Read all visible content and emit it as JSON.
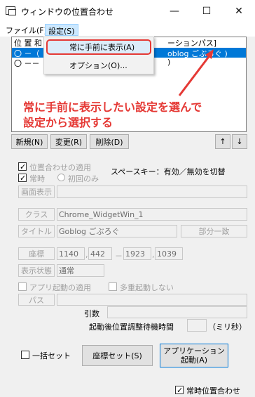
{
  "window": {
    "title": "ウィンドウの位置合わせ",
    "minimize": "—",
    "maximize": "☐",
    "close": "✕"
  },
  "menubar": {
    "file": "ファイル(F)",
    "settings": "設定(S)"
  },
  "dropdown": {
    "always_on_top": "常に手前に表示(A)",
    "options": "オプション(O)..."
  },
  "list": {
    "header_left": "位 置 和",
    "header_right": "ーションパス]",
    "row1_left": "〇 －（",
    "row1_right": "oblog ごぶろぐ )",
    "row2_left": "〇 －－",
    "row2_right": ")"
  },
  "annotation": {
    "line1": "常に手前に表示したい設定を選んで",
    "line2": "設定から選択する"
  },
  "buttons": {
    "new": "新規(N)",
    "edit": "変更(R)",
    "delete": "削除(D)",
    "up": "↑",
    "down": "↓"
  },
  "form": {
    "apply_position": "位置合わせの適用",
    "space_key_hint": "スペースキー：有効／無効を切替",
    "always": "常時",
    "first_only": "初回のみ",
    "screen_label": "画面表示",
    "class_label": "クラス",
    "class_value": "Chrome_WidgetWin_1",
    "title_label": "タイトル",
    "title_value": "Goblog ごぶろぐ",
    "partial_match": "部分一致",
    "coords_label": "座標",
    "x1": "1140",
    "y1": "442",
    "dash": "－",
    "x2": "1923",
    "y2": "1039",
    "display_state_label": "表示状態",
    "display_state_value": "通常",
    "apply_app_launch": "アプリ起動の適用",
    "no_multi_launch": "多重起動しない",
    "path_label": "パス",
    "args_label": "引数",
    "wait_label": "起動後位置調整待機時間",
    "wait_unit": "（ミリ秒）"
  },
  "bottom": {
    "bulk_set": "一括セット",
    "coord_set": "座標セット(S)",
    "app_launch_l1": "アプリケーション",
    "app_launch_l2": "起動(A)",
    "always_align": "常時位置合わせ"
  }
}
